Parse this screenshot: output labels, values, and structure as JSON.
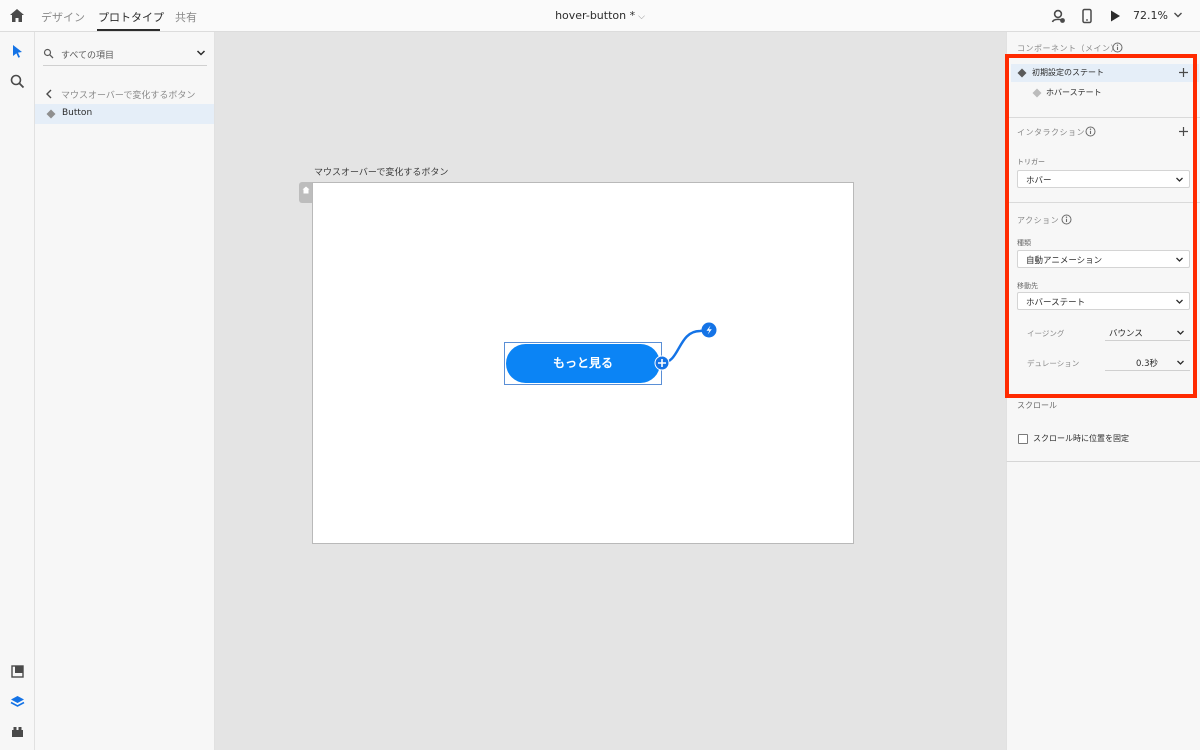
{
  "topbar": {
    "tabs": [
      {
        "label": "デザイン",
        "active": false
      },
      {
        "label": "プロトタイプ",
        "active": true
      },
      {
        "label": "共有",
        "active": false
      }
    ],
    "document_title": "hover-button *",
    "zoom": "72.1%"
  },
  "layers": {
    "search_placeholder": "すべての項目",
    "breadcrumb": "マウスオーバーで変化するボタン",
    "items": [
      {
        "label": "Button",
        "selected": true
      }
    ]
  },
  "canvas": {
    "artboard_name": "マウスオーバーで変化するボタン",
    "button_label": "もっと見る"
  },
  "properties": {
    "component_title": "コンポーネント（メイン）",
    "states": [
      {
        "label": "初期設定のステート",
        "selected": true
      },
      {
        "label": "ホバーステート",
        "selected": false
      }
    ],
    "interaction_title": "インタラクション",
    "trigger_label": "トリガー",
    "trigger_value": "ホバー",
    "action_title": "アクション",
    "type_label": "種類",
    "type_value": "自動アニメーション",
    "destination_label": "移動先",
    "destination_value": "ホバーステート",
    "easing_label": "イージング",
    "easing_value": "バウンス",
    "duration_label": "デュレーション",
    "duration_value": "0.3秒",
    "scroll_title": "スクロール",
    "scroll_fix_label": "スクロール時に位置を固定",
    "scroll_fix_checked": false
  },
  "colors": {
    "accent": "#0b84f5",
    "highlight": "#ff2a00",
    "selection_bg": "#e5eef8"
  }
}
